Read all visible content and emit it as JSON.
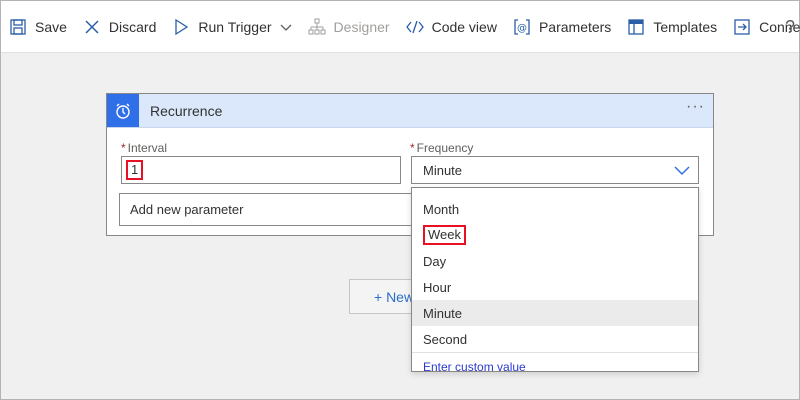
{
  "toolbar": {
    "save": "Save",
    "discard": "Discard",
    "run_trigger": "Run Trigger",
    "designer": "Designer",
    "code_view": "Code view",
    "parameters": "Parameters",
    "templates": "Templates",
    "connectors": "Connectors",
    "help": "?"
  },
  "card": {
    "title": "Recurrence",
    "more": "···",
    "interval_label": "Interval",
    "interval_value": "1",
    "frequency_label": "Frequency",
    "frequency_value": "Minute",
    "required_mark": "*",
    "add_param_placeholder": "Add new parameter"
  },
  "new_step": "+ New",
  "dropdown": {
    "options": [
      "Month",
      "Week",
      "Day",
      "Hour",
      "Minute",
      "Second"
    ],
    "selected": "Minute",
    "highlighted": "Week",
    "custom": "Enter custom value"
  },
  "colors": {
    "accent": "#2f6fe8",
    "header_bg": "#dbe8fc",
    "highlight_red": "#e81123",
    "link": "#2c3ad0"
  }
}
